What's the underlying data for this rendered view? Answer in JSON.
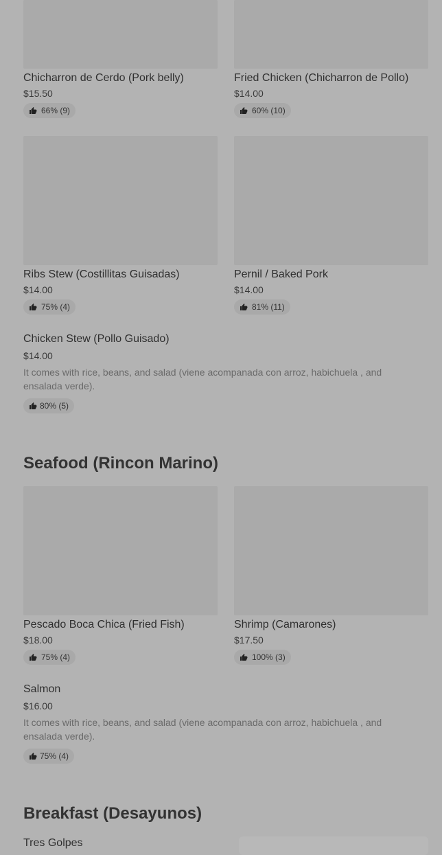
{
  "items": [
    {
      "title": "Chicharron de Cerdo (Pork belly)",
      "price": "$15.50",
      "rating": "66% (9)"
    },
    {
      "title": "Fried Chicken (Chicharron de Pollo)",
      "price": "$14.00",
      "rating": "60% (10)"
    },
    {
      "title": "Ribs Stew (Costillitas Guisadas)",
      "price": "$14.00",
      "rating": "75% (4)"
    },
    {
      "title": "Pernil / Baked Pork",
      "price": "$14.00",
      "rating": "81% (11)"
    },
    {
      "title": "Chicken Stew (Pollo Guisado)",
      "price": "$14.00",
      "description": "It comes with rice, beans, and salad (viene acompanada con arroz, habichuela , and ensalada verde).",
      "rating": "80% (5)"
    },
    {
      "title": "Pescado Boca Chica (Fried Fish)",
      "price": "$18.00",
      "rating": "75% (4)"
    },
    {
      "title": "Shrimp (Camarones)",
      "price": "$17.50",
      "rating": "100% (3)"
    },
    {
      "title": "Salmon",
      "price": "$16.00",
      "description": "It comes with rice, beans, and salad (viene acompanada con arroz, habichuela , and ensalada verde).",
      "rating": "75% (4)"
    },
    {
      "title": "Tres Golpes"
    }
  ],
  "sections": {
    "seafood": "Seafood (Rincon Marino)",
    "breakfast": "Breakfast (Desayunos)"
  },
  "icons": {
    "rating": "thumbs-up-icon"
  },
  "colors": {
    "background": "#b3b3b3",
    "image_placeholder": "#aaaaaa",
    "badge_bg": "#a9a9a9"
  }
}
